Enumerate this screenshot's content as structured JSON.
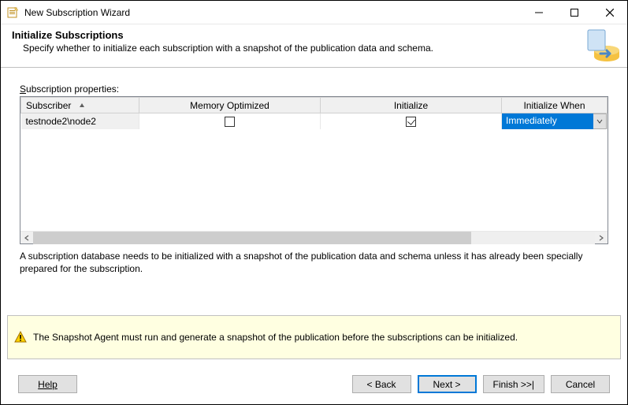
{
  "window": {
    "title": "New Subscription Wizard"
  },
  "header": {
    "title": "Initialize Subscriptions",
    "subtitle": "Specify whether to initialize each subscription with a snapshot of the publication data and schema."
  },
  "label": {
    "prefix_letter": "S",
    "rest": "ubscription properties:"
  },
  "table": {
    "columns": {
      "subscriber": "Subscriber",
      "memory": "Memory Optimized",
      "initialize": "Initialize",
      "when": "Initialize When"
    },
    "rows": [
      {
        "subscriber": "testnode2\\node2",
        "memory_optimized": false,
        "initialize": true,
        "initialize_when": "Immediately"
      }
    ]
  },
  "note": "A subscription database needs to be initialized with a snapshot of the publication data and schema unless it has already been specially prepared for the subscription.",
  "alert": "The Snapshot Agent must run and generate a snapshot of the publication before the subscriptions can be initialized.",
  "buttons": {
    "help": "Help",
    "back": "< Back",
    "next": "Next >",
    "finish": "Finish >>|",
    "cancel": "Cancel"
  }
}
